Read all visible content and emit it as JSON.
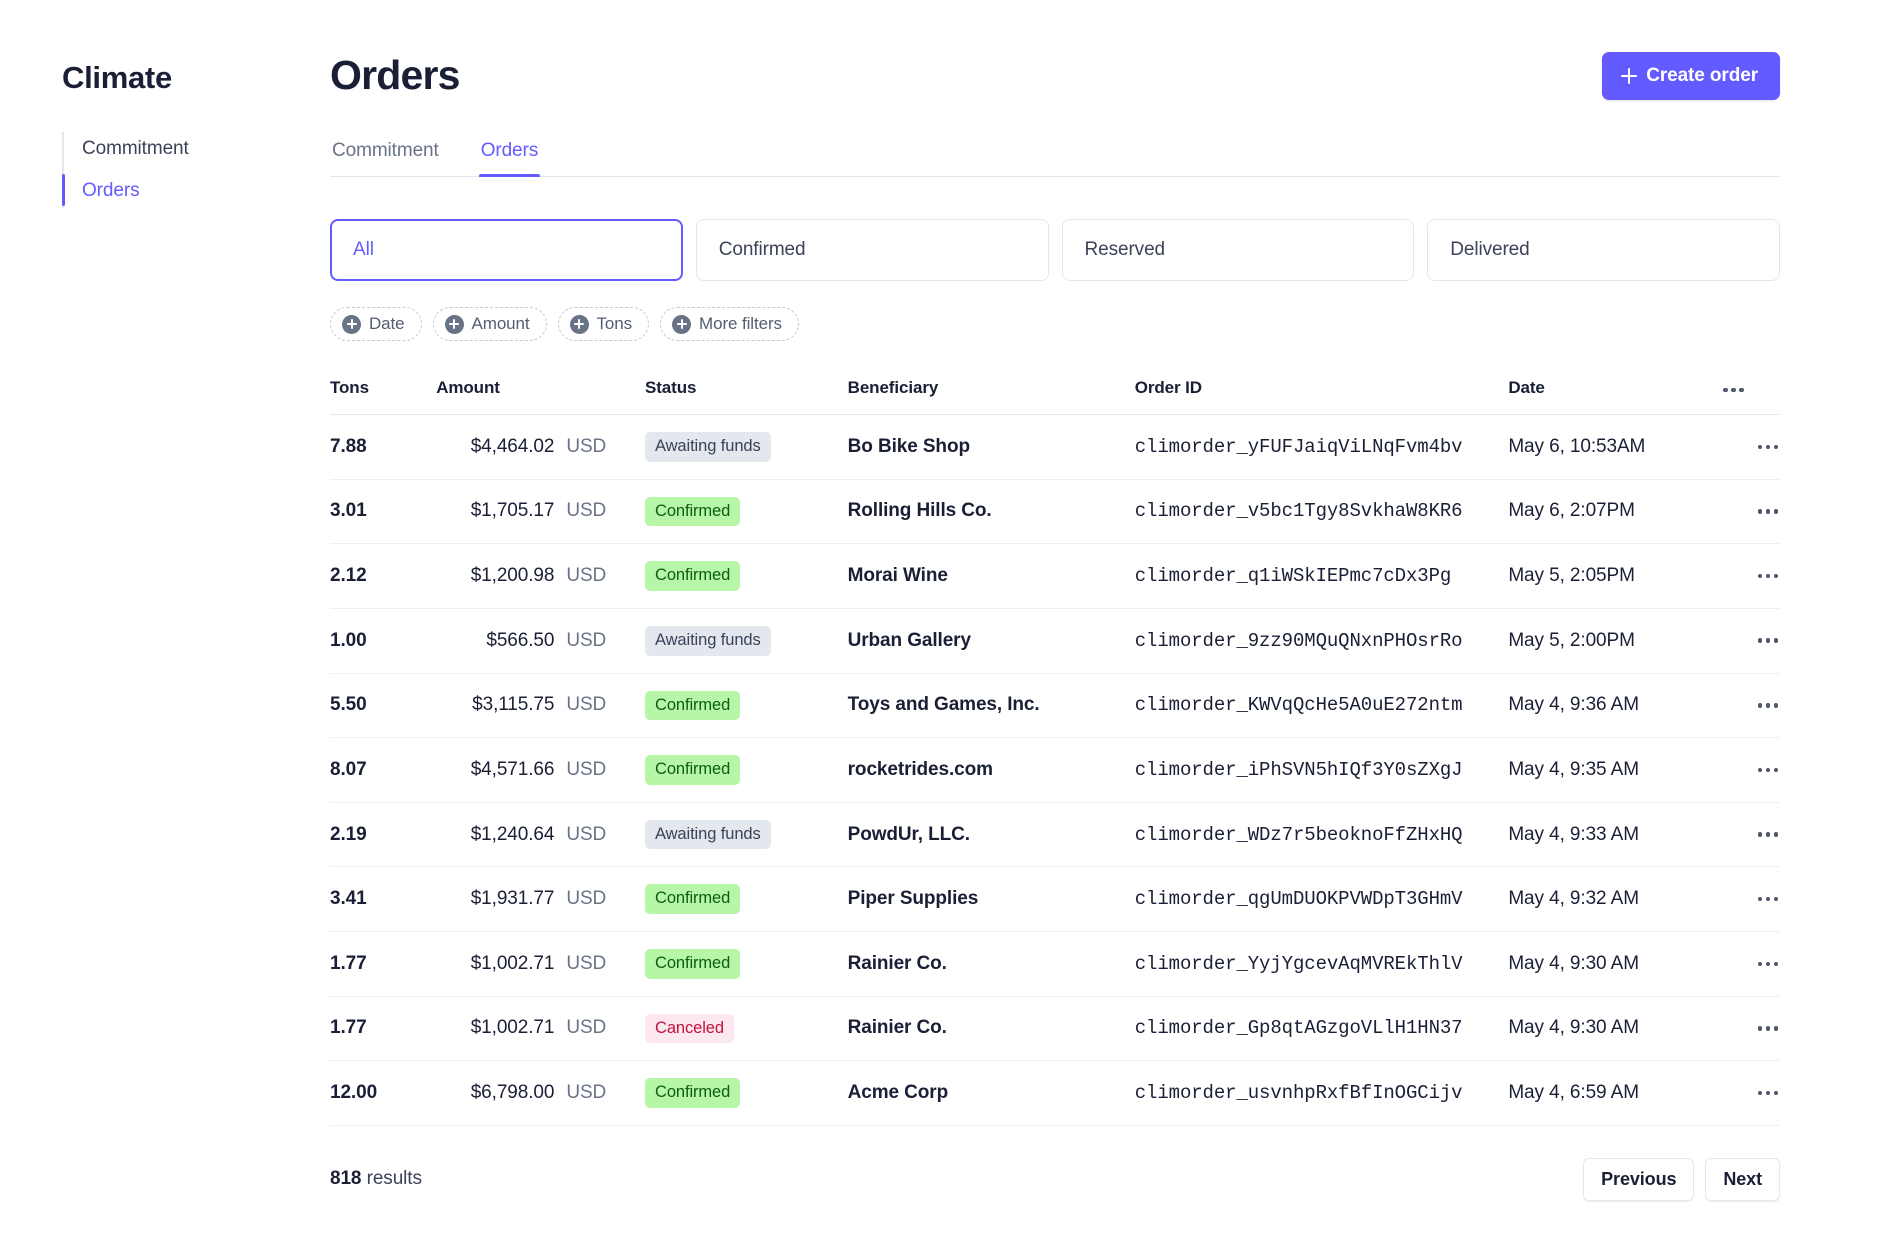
{
  "sidebar": {
    "brand": "Climate",
    "items": [
      {
        "label": "Commitment",
        "active": false
      },
      {
        "label": "Orders",
        "active": true
      }
    ]
  },
  "header": {
    "title": "Orders",
    "create_button": "Create order",
    "create_icon": "plus-icon"
  },
  "tabs": [
    {
      "label": "Commitment",
      "active": false
    },
    {
      "label": "Orders",
      "active": true
    }
  ],
  "status_filters": [
    {
      "label": "All",
      "selected": true
    },
    {
      "label": "Confirmed",
      "selected": false
    },
    {
      "label": "Reserved",
      "selected": false
    },
    {
      "label": "Delivered",
      "selected": false
    }
  ],
  "chip_filters": [
    {
      "label": "Date",
      "icon": "plus-circle-icon"
    },
    {
      "label": "Amount",
      "icon": "plus-circle-icon"
    },
    {
      "label": "Tons",
      "icon": "plus-circle-icon"
    },
    {
      "label": "More filters",
      "icon": "plus-circle-icon"
    }
  ],
  "table": {
    "columns": [
      "Tons",
      "Amount",
      "Status",
      "Beneficiary",
      "Order ID",
      "Date"
    ],
    "overflow_icon": "ellipsis-icon",
    "rows": [
      {
        "tons": "7.88",
        "amount": "$4,464.02",
        "currency": "USD",
        "status": "Awaiting funds",
        "status_type": "awaiting",
        "beneficiary": "Bo Bike Shop",
        "order_id": "climorder_yFUFJaiqViLNqFvm4bv",
        "date": "May 6, 10:53AM"
      },
      {
        "tons": "3.01",
        "amount": "$1,705.17",
        "currency": "USD",
        "status": "Confirmed",
        "status_type": "confirmed",
        "beneficiary": "Rolling Hills Co.",
        "order_id": "climorder_v5bc1Tgy8SvkhaW8KR6",
        "date": "May 6, 2:07PM"
      },
      {
        "tons": "2.12",
        "amount": "$1,200.98",
        "currency": "USD",
        "status": "Confirmed",
        "status_type": "confirmed",
        "beneficiary": "Morai Wine",
        "order_id": "climorder_q1iWSkIEPmc7cDx3Pg",
        "date": "May 5, 2:05PM"
      },
      {
        "tons": "1.00",
        "amount": "$566.50",
        "currency": "USD",
        "status": "Awaiting funds",
        "status_type": "awaiting",
        "beneficiary": "Urban Gallery",
        "order_id": "climorder_9zz90MQuQNxnPHOsrRo",
        "date": "May 5, 2:00PM"
      },
      {
        "tons": "5.50",
        "amount": "$3,115.75",
        "currency": "USD",
        "status": "Confirmed",
        "status_type": "confirmed",
        "beneficiary": "Toys and Games, Inc.",
        "order_id": "climorder_KWVqQcHe5A0uE272ntm",
        "date": "May 4, 9:36 AM"
      },
      {
        "tons": "8.07",
        "amount": "$4,571.66",
        "currency": "USD",
        "status": "Confirmed",
        "status_type": "confirmed",
        "beneficiary": "rocketrides.com",
        "order_id": "climorder_iPhSVN5hIQf3Y0sZXgJ",
        "date": "May 4, 9:35 AM"
      },
      {
        "tons": "2.19",
        "amount": "$1,240.64",
        "currency": "USD",
        "status": "Awaiting funds",
        "status_type": "awaiting",
        "beneficiary": "PowdUr, LLC.",
        "order_id": "climorder_WDz7r5beoknoFfZHxHQ",
        "date": "May 4, 9:33 AM"
      },
      {
        "tons": "3.41",
        "amount": "$1,931.77",
        "currency": "USD",
        "status": "Confirmed",
        "status_type": "confirmed",
        "beneficiary": "Piper Supplies",
        "order_id": "climorder_qgUmDUOKPVWDpT3GHmV",
        "date": "May 4, 9:32 AM"
      },
      {
        "tons": "1.77",
        "amount": "$1,002.71",
        "currency": "USD",
        "status": "Confirmed",
        "status_type": "confirmed",
        "beneficiary": "Rainier Co.",
        "order_id": "climorder_YyjYgcevAqMVREkThlV",
        "date": "May 4, 9:30 AM"
      },
      {
        "tons": "1.77",
        "amount": "$1,002.71",
        "currency": "USD",
        "status": "Canceled",
        "status_type": "canceled",
        "beneficiary": "Rainier Co.",
        "order_id": "climorder_Gp8qtAGzgoVLlH1HN37",
        "date": "May 4, 9:30 AM"
      },
      {
        "tons": "12.00",
        "amount": "$6,798.00",
        "currency": "USD",
        "status": "Confirmed",
        "status_type": "confirmed",
        "beneficiary": "Acme Corp",
        "order_id": "climorder_usvnhpRxfBfInOGCijv",
        "date": "May 4, 6:59 AM"
      }
    ]
  },
  "footer": {
    "results_count": "818",
    "results_label": "results",
    "previous": "Previous",
    "next": "Next"
  },
  "colors": {
    "accent": "#635bff",
    "text": "#1a1f36",
    "muted": "#697386",
    "border": "#e3e8ee",
    "badge_confirmed_bg": "#b6f6a6",
    "badge_confirmed_text": "#0b5d14",
    "badge_awaiting_bg": "#e3e8ee",
    "badge_canceled_bg": "#fde8ef",
    "badge_canceled_text": "#c0123c"
  }
}
